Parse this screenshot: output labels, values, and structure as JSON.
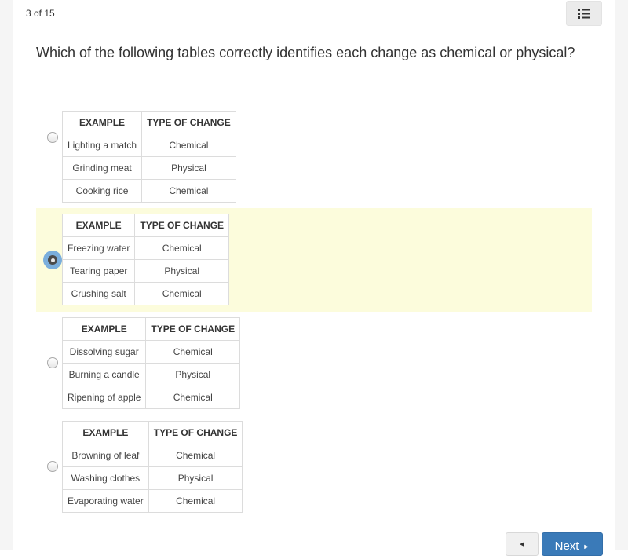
{
  "header": {
    "counter": "3 of 15",
    "menu_icon": "list-icon"
  },
  "question": {
    "text": "Which of the following tables correctly identifies each change as chemical or physical?"
  },
  "table_headers": {
    "example": "EXAMPLE",
    "type": "TYPE OF CHANGE"
  },
  "options": [
    {
      "selected": false,
      "rows": [
        {
          "example": "Lighting a match",
          "type": "Chemical"
        },
        {
          "example": "Grinding meat",
          "type": "Physical"
        },
        {
          "example": "Cooking rice",
          "type": "Chemical"
        }
      ]
    },
    {
      "selected": true,
      "rows": [
        {
          "example": "Freezing water",
          "type": "Chemical"
        },
        {
          "example": "Tearing paper",
          "type": "Physical"
        },
        {
          "example": "Crushing salt",
          "type": "Chemical"
        }
      ]
    },
    {
      "selected": false,
      "rows": [
        {
          "example": "Dissolving sugar",
          "type": "Chemical"
        },
        {
          "example": "Burning a candle",
          "type": "Physical"
        },
        {
          "example": "Ripening of apple",
          "type": "Chemical"
        }
      ]
    },
    {
      "selected": false,
      "rows": [
        {
          "example": "Browning of leaf",
          "type": "Chemical"
        },
        {
          "example": "Washing clothes",
          "type": "Physical"
        },
        {
          "example": "Evaporating water",
          "type": "Chemical"
        }
      ]
    }
  ],
  "nav": {
    "prev_icon": "triangle-left-icon",
    "prev_glyph": "◄",
    "next_label": "Next",
    "next_glyph": "►"
  },
  "colors": {
    "selected_highlight": "#fcfcdc",
    "radio_checked": "#7aaedc",
    "next_button": "#3a7ab8"
  }
}
